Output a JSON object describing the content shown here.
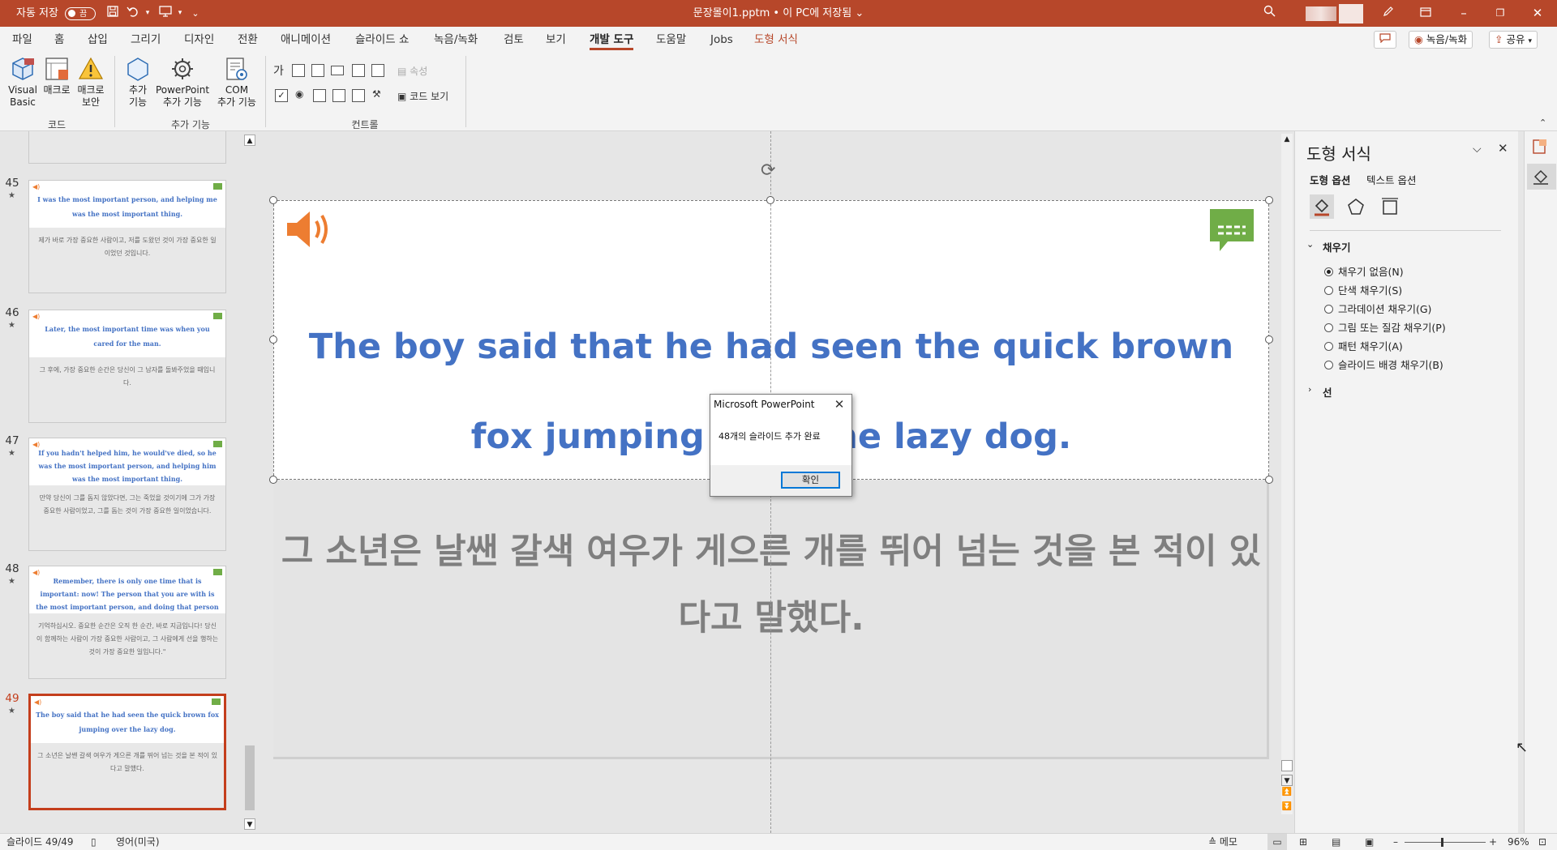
{
  "titlebar": {
    "autosave_label": "자동 저장",
    "autosave_state": "끔",
    "doc_title": "문장몰이1.pptm • 이 PC에 저장됨 ⌄"
  },
  "tabs": [
    "파일",
    "홈",
    "삽입",
    "그리기",
    "디자인",
    "전환",
    "애니메이션",
    "슬라이드 쇼",
    "녹음/녹화",
    "검토",
    "보기",
    "개발 도구",
    "도움말",
    "Jobs",
    "도형 서식"
  ],
  "tab_buttons": {
    "record": "녹음/녹화",
    "share": "공유"
  },
  "ribbon": {
    "code_group": {
      "label": "코드",
      "buttons": [
        {
          "l1": "Visual",
          "l2": "Basic"
        },
        {
          "l1": "매크로",
          "l2": ""
        },
        {
          "l1": "매크로",
          "l2": "보안"
        }
      ]
    },
    "addin_group": {
      "label": "추가 기능",
      "buttons": [
        {
          "l1": "추가",
          "l2": "기능"
        },
        {
          "l1": "PowerPoint",
          "l2": "추가 기능"
        },
        {
          "l1": "COM",
          "l2": "추가 기능"
        }
      ]
    },
    "controls_group": {
      "label": "컨트롤",
      "label_glyph": "가",
      "properties": "속성",
      "view_code": "코드 보기"
    }
  },
  "thumbnails": [
    {
      "num": "45",
      "en": "I was the most important person, and helping me was the most important thing.",
      "ko": "제가 바로 가장 중요한 사람이고, 저를 도왔던 것이 가장 중요한 일이었던 것입니다."
    },
    {
      "num": "46",
      "en": "Later, the most important time was when you cared for the man.",
      "ko": "그 후에, 가장 중요한 순간은 당신이 그 남자를 돌봐주었을 때입니다."
    },
    {
      "num": "47",
      "en": "If you hadn't helped him, he would've died, so he was the most important person, and helping him was the most important thing.",
      "ko": "만약 당신이 그를 돕지 않았다면, 그는 죽었을 것이기에 그가 가장 중요한 사람이었고, 그를 돕는 것이 가장 중요한 일이었습니다."
    },
    {
      "num": "48",
      "en": "Remember, there is only one time that is important: now! The person that you are with is the most important person, and doing that person good is the most important thing.\"",
      "ko": "기억하십시오. 중요한 순간은 오직 한 순간, 바로 지금입니다! 당신이 함께하는 사람이 가장 중요한 사람이고, 그 사람에게 선을 행하는 것이 가장 중요한 일입니다.\""
    },
    {
      "num": "49",
      "en": "The boy said that he had seen the quick brown fox jumping over the lazy dog.",
      "ko": "그 소년은 날쌘 갈색 여우가 게으른 개를 뛰어 넘는 것을 본 적이 있다고 말했다."
    }
  ],
  "slide": {
    "english": "The boy said that he had seen the quick brown fox jumping over the lazy dog.",
    "korean": "그 소년은 날쌘 갈색 여우가 게으른 개를 뛰어 넘는 것을 본 적이 있다고 말했다."
  },
  "dialog": {
    "title": "Microsoft PowerPoint",
    "message": "48개의 슬라이드 추가 완료",
    "ok": "확인"
  },
  "format_pane": {
    "title": "도형 서식",
    "tab_shape": "도형 옵션",
    "tab_text": "텍스트 옵션",
    "fill_section": "채우기",
    "fill_options": [
      "채우기 없음(N)",
      "단색 채우기(S)",
      "그라데이션 채우기(G)",
      "그림 또는 질감 채우기(P)",
      "패턴 채우기(A)",
      "슬라이드 배경 채우기(B)"
    ],
    "fill_selected": 0,
    "line_section": "선"
  },
  "status": {
    "slide_pos": "슬라이드 49/49",
    "language": "영어(미국)",
    "notes": "메모",
    "zoom": "96%"
  },
  "colors": {
    "accent": "#b7472a",
    "slide_text_blue": "#4472c4",
    "slide_text_gray": "#7f7f7f",
    "speaker_orange": "#ed7d31",
    "comment_green": "#70ad47"
  }
}
